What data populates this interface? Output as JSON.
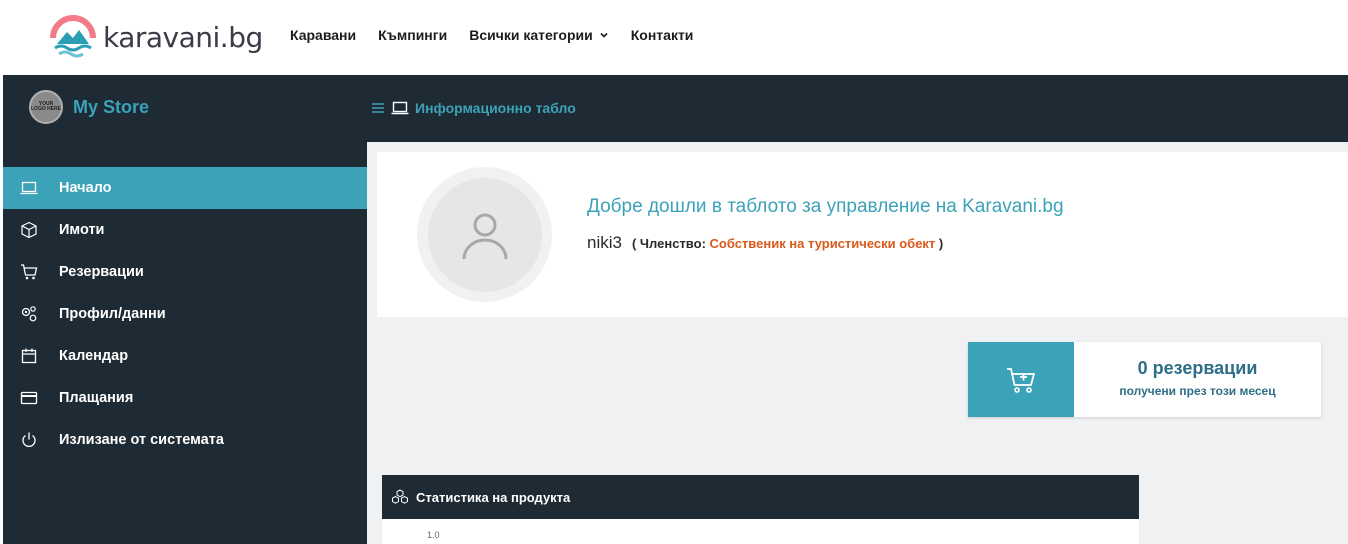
{
  "site": {
    "logo_text": "karavani.bg",
    "nav": [
      {
        "label": "Каравани"
      },
      {
        "label": "Къмпинги"
      },
      {
        "label": "Всички категории"
      },
      {
        "label": "Контакти"
      }
    ]
  },
  "dashboard_header": {
    "store_logo_text": "YOUR LOGO HERE",
    "store_name": "My Store",
    "title": "Информационно табло"
  },
  "sidebar": {
    "items": [
      {
        "label": "Начало",
        "icon": "laptop-icon",
        "active": true
      },
      {
        "label": "Имоти",
        "icon": "box-icon"
      },
      {
        "label": "Резервации",
        "icon": "cart-icon"
      },
      {
        "label": "Профил/данни",
        "icon": "gears-icon"
      },
      {
        "label": "Календар",
        "icon": "calendar-icon"
      },
      {
        "label": "Плащания",
        "icon": "credit-card-icon"
      },
      {
        "label": "Излизане от системата",
        "icon": "power-icon"
      }
    ]
  },
  "welcome": {
    "title": "Добре дошли в таблото за управление на Karavani.bg",
    "username": "niki3",
    "membership_open": "( Членство: ",
    "membership_role": "Собственик на туристически обект",
    "membership_close": " )"
  },
  "reservations_card": {
    "count_text": "0 резервации",
    "subtitle": "получени през този месец"
  },
  "stats": {
    "title": "Статистика на продукта",
    "axis_tick": "1.0"
  },
  "colors": {
    "accent": "#3ba2b8",
    "dark": "#1f2b34",
    "membership_role": "#d95a1a"
  }
}
